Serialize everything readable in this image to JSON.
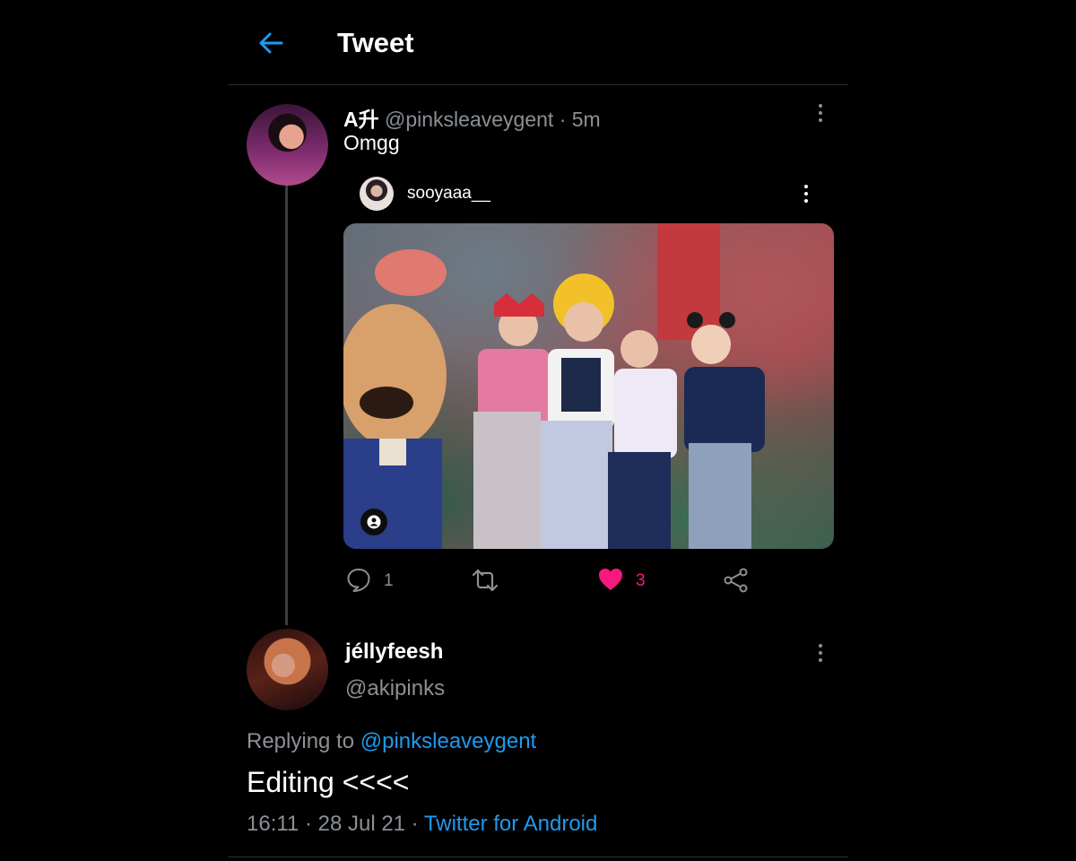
{
  "header": {
    "title": "Tweet",
    "back_icon": "arrow-left-icon"
  },
  "tweet": {
    "display_name": "A升",
    "handle": "@pinksleaveygent",
    "separator": "·",
    "time": "5m",
    "text": "Omgg",
    "embedded": {
      "username": "sooyaaa__"
    },
    "actions": {
      "reply_count": "1",
      "retweet_count": "",
      "like_count": "3",
      "liked": true
    }
  },
  "reply": {
    "display_name": "jéllyfeesh",
    "handle": "@akipinks",
    "replying_prefix": "Replying to",
    "replying_to": "@pinksleaveygent",
    "text": "Editing <<<<",
    "time": "16:11",
    "date": "28 Jul 21",
    "source": "Twitter for Android"
  },
  "colors": {
    "accent": "#1d9bf0",
    "like": "#f91880",
    "muted": "#8b9095",
    "background": "#000000"
  }
}
